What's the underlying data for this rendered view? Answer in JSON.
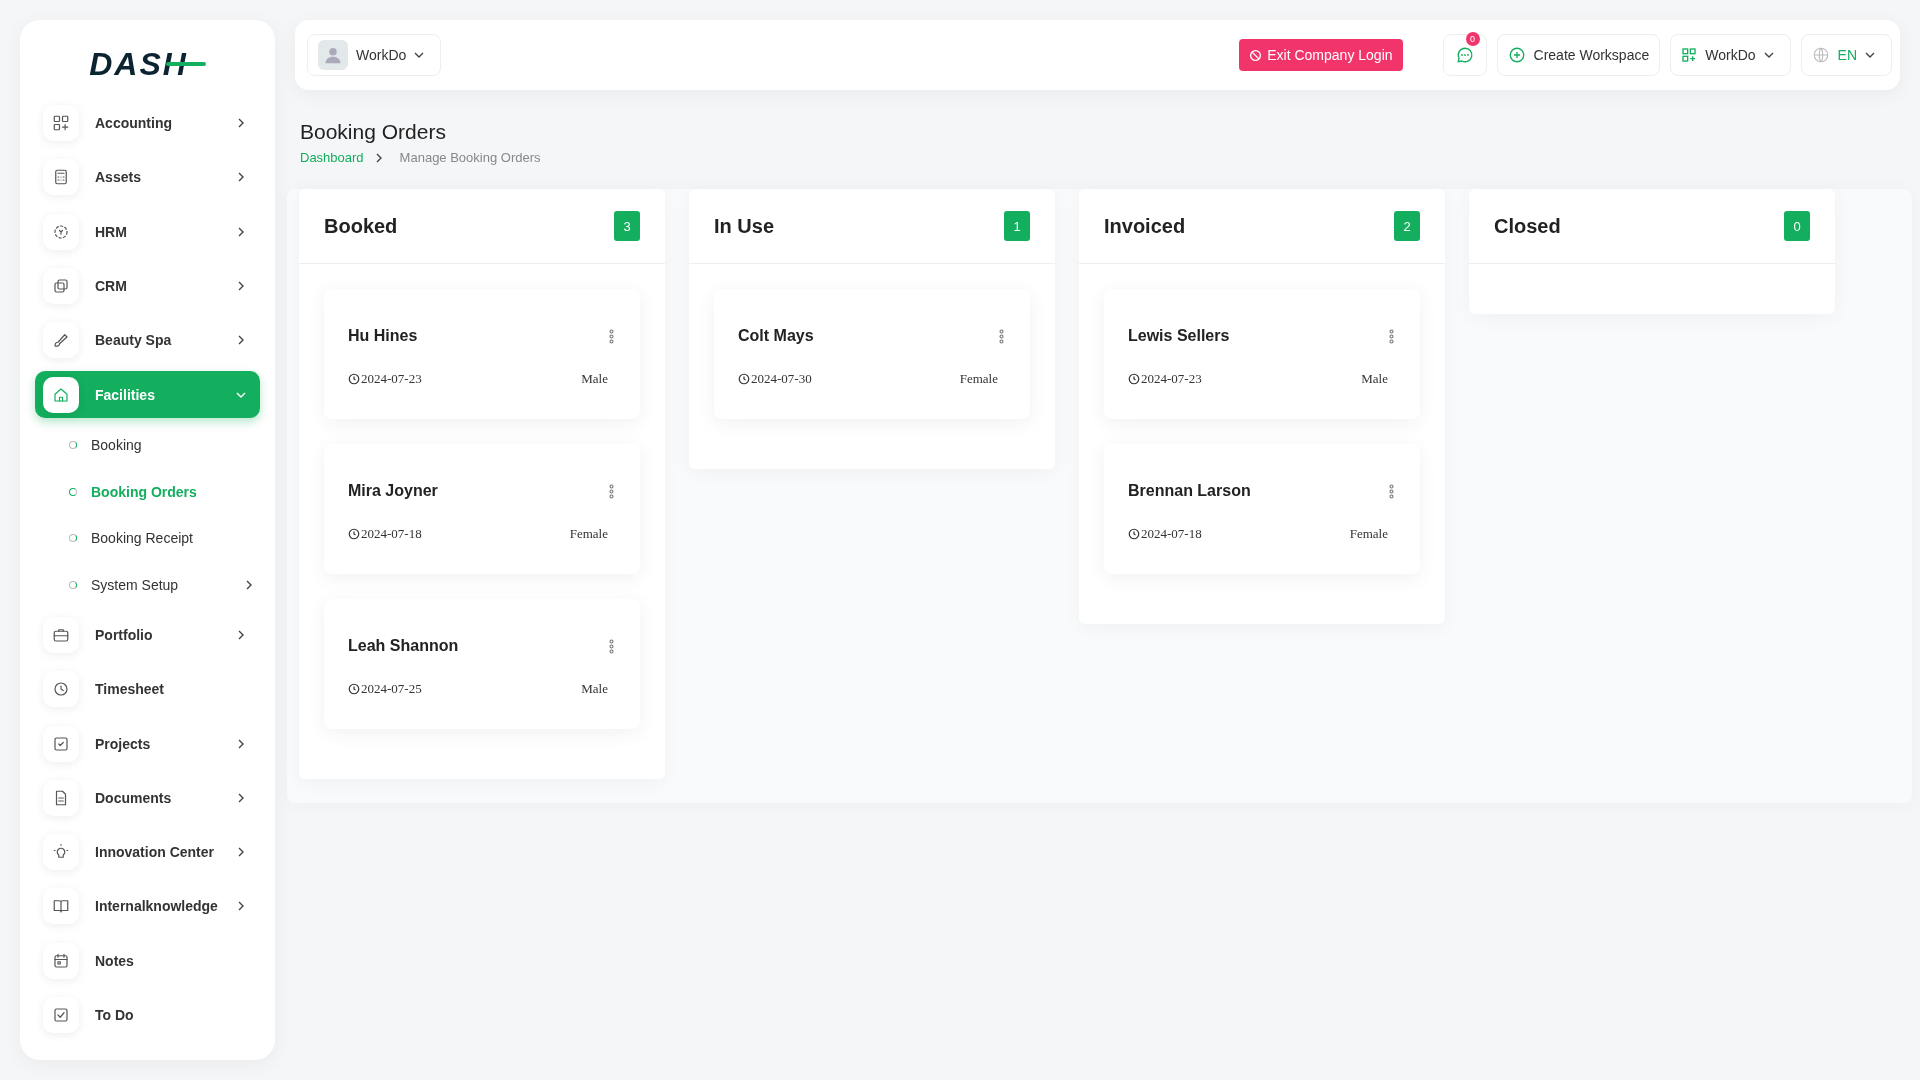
{
  "sidebar": {
    "logo": "DASH",
    "items": [
      {
        "label": "Accounting",
        "has_submenu": true,
        "selected": false,
        "expanded": false
      },
      {
        "label": "Assets",
        "has_submenu": true,
        "selected": false,
        "expanded": false
      },
      {
        "label": "HRM",
        "has_submenu": true,
        "selected": false,
        "expanded": false
      },
      {
        "label": "CRM",
        "has_submenu": true,
        "selected": false,
        "expanded": false
      },
      {
        "label": "Beauty Spa",
        "has_submenu": true,
        "selected": false,
        "expanded": false
      },
      {
        "label": "Facilities",
        "has_submenu": true,
        "selected": true,
        "expanded": true,
        "children": [
          {
            "label": "Booking",
            "selected": false,
            "has_submenu": false
          },
          {
            "label": "Booking Orders",
            "selected": true,
            "has_submenu": false
          },
          {
            "label": "Booking Receipt",
            "selected": false,
            "has_submenu": false
          },
          {
            "label": "System Setup",
            "selected": false,
            "has_submenu": true
          }
        ]
      },
      {
        "label": "Portfolio",
        "has_submenu": true,
        "selected": false,
        "expanded": false
      },
      {
        "label": "Timesheet",
        "has_submenu": false,
        "selected": false,
        "expanded": false
      },
      {
        "label": "Projects",
        "has_submenu": true,
        "selected": false,
        "expanded": false
      },
      {
        "label": "Documents",
        "has_submenu": true,
        "selected": false,
        "expanded": false
      },
      {
        "label": "Innovation Center",
        "has_submenu": true,
        "selected": false,
        "expanded": false
      },
      {
        "label": "Internalknowledge",
        "has_submenu": true,
        "selected": false,
        "expanded": false
      },
      {
        "label": "Notes",
        "has_submenu": false,
        "selected": false,
        "expanded": false
      },
      {
        "label": "To Do",
        "has_submenu": false,
        "selected": false,
        "expanded": false
      }
    ]
  },
  "header": {
    "company": "WorkDo",
    "exit_button": "Exit Company Login",
    "notification_count": "0",
    "create_workspace": "Create Workspace",
    "workspace": "WorkDo",
    "language": "EN"
  },
  "page": {
    "title": "Booking Orders",
    "breadcrumb": [
      "Dashboard",
      "Manage Booking Orders"
    ]
  },
  "board": {
    "columns": [
      {
        "title": "Booked",
        "count": "3",
        "cards": [
          {
            "name": "Hu Hines",
            "date": "2024-07-23",
            "gender": "Male"
          },
          {
            "name": "Mira Joyner",
            "date": "2024-07-18",
            "gender": "Female"
          },
          {
            "name": "Leah Shannon",
            "date": "2024-07-25",
            "gender": "Male"
          }
        ]
      },
      {
        "title": "In Use",
        "count": "1",
        "cards": [
          {
            "name": "Colt Mays",
            "date": "2024-07-30",
            "gender": "Female"
          }
        ]
      },
      {
        "title": "Invoiced",
        "count": "2",
        "cards": [
          {
            "name": "Lewis Sellers",
            "date": "2024-07-23",
            "gender": "Male"
          },
          {
            "name": "Brennan Larson",
            "date": "2024-07-18",
            "gender": "Female"
          }
        ]
      },
      {
        "title": "Closed",
        "count": "0"
      }
    ]
  }
}
